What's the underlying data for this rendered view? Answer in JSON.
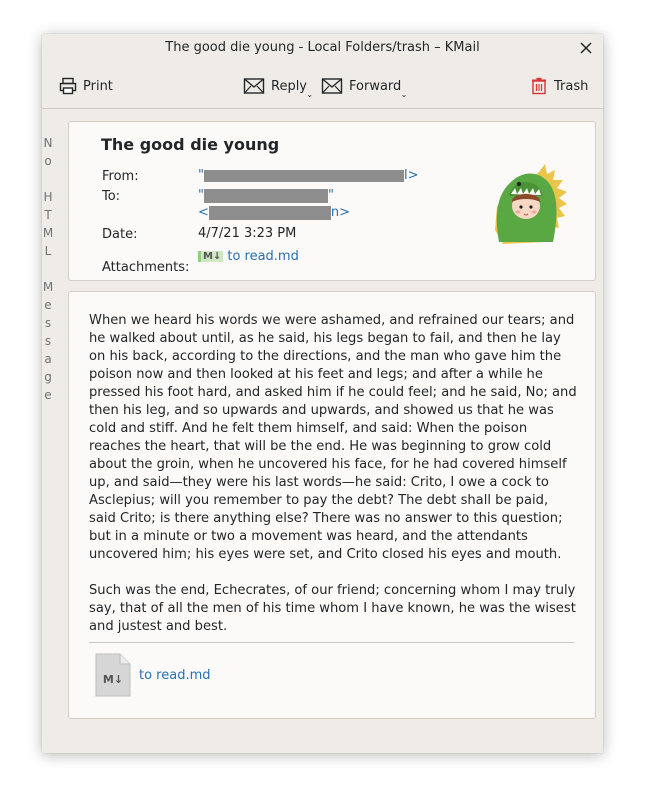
{
  "window": {
    "title": "The good die young - Local Folders/trash – KMail"
  },
  "toolbar": {
    "print_label": "Print",
    "reply_label": "Reply",
    "forward_label": "Forward",
    "trash_label": "Trash"
  },
  "sidebar": {
    "no_html_letters": [
      "N",
      "o",
      "",
      "H",
      "T",
      "M",
      "L",
      "",
      "M",
      "e",
      "s",
      "s",
      "a",
      "g",
      "e"
    ]
  },
  "header": {
    "subject": "The good die young",
    "from_label": "From:",
    "from_value_start": "\"",
    "from_value_end": "l>",
    "to_label": "To:",
    "to_value_line1_start": "\"",
    "to_value_line1_end": "\"",
    "to_value_line2_start": "<",
    "to_value_line2_end": "n>",
    "date_label": "Date:",
    "date_value": "4/7/21 3:23 PM",
    "attachments_label": "Attachments:",
    "attachment_name": "to read.md"
  },
  "body": {
    "paragraph1": "When we heard his words we were ashamed, and refrained our tears; and he walked about until, as he said, his legs began to fail, and then he lay on his back, according to the directions, and the man who gave him the poison now and then looked at his feet and legs; and after a while he pressed his foot hard, and asked him if he could feel; and he said, No; and then his leg, and so upwards and upwards, and showed us that he was cold and stiff. And he felt them himself, and said: When the poison reaches the heart, that will be the end. He was beginning to grow cold about the groin, when he uncovered his face, for he had covered himself up, and said—they were his last words—he said: Crito, I owe a cock to Asclepius; will you remember to pay the debt? The debt shall be paid, said Crito; is there anything else? There was no answer to this question; but in a minute or two a movement was heard, and the attendants uncovered him; his eyes were set, and Crito closed his eyes and mouth.",
    "paragraph2": "Such was the end, Echecrates, of our friend; concerning whom I may truly say, that of all the men of his time whom I have known, he was the wisest and justest and best."
  },
  "attachment_block": {
    "file_name": "to read.md",
    "icon_text": "M↓"
  },
  "colors": {
    "link": "#2a6fb0",
    "window_bg": "#efece7",
    "panel_bg": "#fbfaf8",
    "trash_red": "#d9333a",
    "dino_green": "#5aa843"
  },
  "icons": {
    "print": "printer-icon",
    "reply": "envelope-reply-icon",
    "forward": "envelope-forward-icon",
    "trash": "trash-icon",
    "close": "close-icon",
    "markdown": "markdown-file-icon"
  }
}
